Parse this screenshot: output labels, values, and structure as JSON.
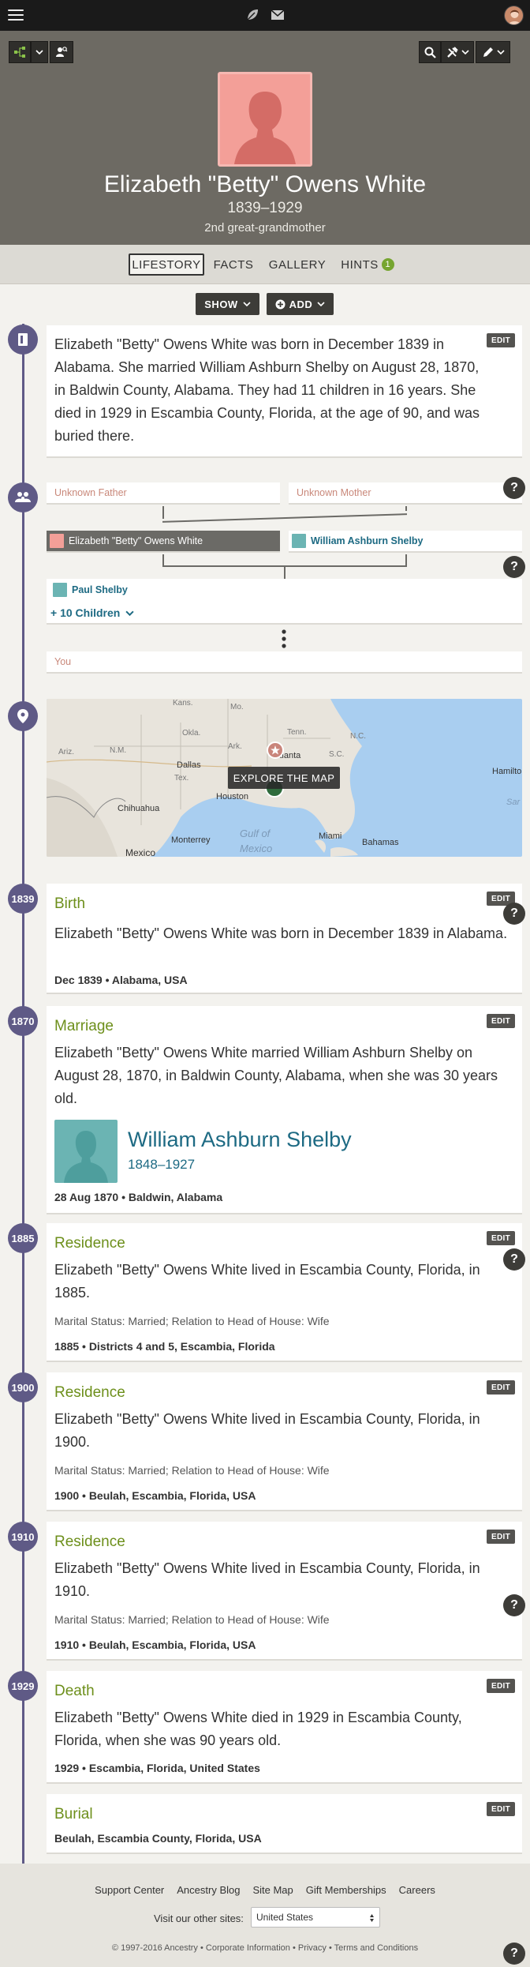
{
  "topbar": {
    "menu": "menu",
    "icons": [
      "leaf-icon",
      "mail-icon",
      "avatar"
    ]
  },
  "person": {
    "name": "Elizabeth \"Betty\" Owens White",
    "dates": "1839–1929",
    "relation": "2nd great-grandmother"
  },
  "tabs": [
    {
      "label": "LIFESTORY",
      "active": true
    },
    {
      "label": "FACTS"
    },
    {
      "label": "GALLERY"
    },
    {
      "label": "HINTS",
      "badge": "1"
    }
  ],
  "actions": {
    "show": "SHOW",
    "add": "ADD"
  },
  "story": "Elizabeth \"Betty\" Owens White was born in December 1839 in Alabama. She married William Ashburn Shelby on August 28, 1870, in Baldwin County, Alabama. They had 11 children in 16 years. She died in 1929 in Escambia County, Florida, at the age of 90, and was buried there.",
  "edit_label": "EDIT",
  "help_label": "?",
  "family": {
    "father": "Unknown Father",
    "mother": "Unknown Mother",
    "self": "Elizabeth \"Betty\" Owens White",
    "spouse": "William Ashburn Shelby",
    "child": "Paul Shelby",
    "more_children": "+ 10 Children",
    "you": "You"
  },
  "map": {
    "explore": "EXPLORE THE MAP",
    "labels": [
      "Kans.",
      "Mo.",
      "Tenn.",
      "N.C.",
      "S.C.",
      "Okla.",
      "Ark.",
      "Ariz.",
      "N.M.",
      "Dallas",
      "Tex.",
      "Atlanta",
      "Hamilto",
      "Houston",
      "Chihuahua",
      "Monterrey",
      "Gulf of",
      "Mexico",
      "Miami",
      "Bahamas",
      "Mexico",
      "Sar"
    ]
  },
  "events": [
    {
      "year": "1839",
      "title": "Birth",
      "desc": "Elizabeth \"Betty\" Owens White was born in December 1839 in Alabama.",
      "meta": "Dec 1839 • Alabama, USA"
    },
    {
      "year": "1870",
      "title": "Marriage",
      "desc": "Elizabeth \"Betty\" Owens White married William Ashburn Shelby on August 28, 1870, in Baldwin County, Alabama, when she was 30 years old.",
      "spouse_name": "William Ashburn Shelby",
      "spouse_dates": "1848–1927",
      "meta": "28 Aug 1870 • Baldwin, Alabama"
    },
    {
      "year": "1885",
      "title": "Residence",
      "desc": "Elizabeth \"Betty\" Owens White lived in Escambia County, Florida, in 1885.",
      "detail": "Marital Status: Married; Relation to Head of House: Wife",
      "meta": "1885 • Districts 4 and 5, Escambia, Florida"
    },
    {
      "year": "1900",
      "title": "Residence",
      "desc": "Elizabeth \"Betty\" Owens White lived in Escambia County, Florida, in 1900.",
      "detail": "Marital Status: Married; Relation to Head of House: Wife",
      "meta": "1900 • Beulah, Escambia, Florida, USA"
    },
    {
      "year": "1910",
      "title": "Residence",
      "desc": "Elizabeth \"Betty\" Owens White lived in Escambia County, Florida, in 1910.",
      "detail": "Marital Status: Married; Relation to Head of House: Wife",
      "meta": "1910 • Beulah, Escambia, Florida, USA"
    },
    {
      "year": "1929",
      "title": "Death",
      "desc": "Elizabeth \"Betty\" Owens White died in 1929 in Escambia County, Florida, when she was 90 years old.",
      "meta": "1929 • Escambia, Florida, United States"
    },
    {
      "title": "Burial",
      "meta": "Beulah, Escambia County, Florida, USA"
    }
  ],
  "footer": {
    "links": [
      "Support Center",
      "Ancestry Blog",
      "Site Map",
      "Gift Memberships",
      "Careers"
    ],
    "other_sites": "Visit our other sites:",
    "selected_site": "United States",
    "copyright": "© 1997-2016 Ancestry  •  Corporate Information  •  Privacy  •  Terms and Conditions"
  },
  "colors": {
    "timeline": "#5f5a86",
    "event_title": "#6d8f1b",
    "spouse": "#1d6a83",
    "hero": "#6d6a63",
    "hint_badge": "#76a530"
  }
}
